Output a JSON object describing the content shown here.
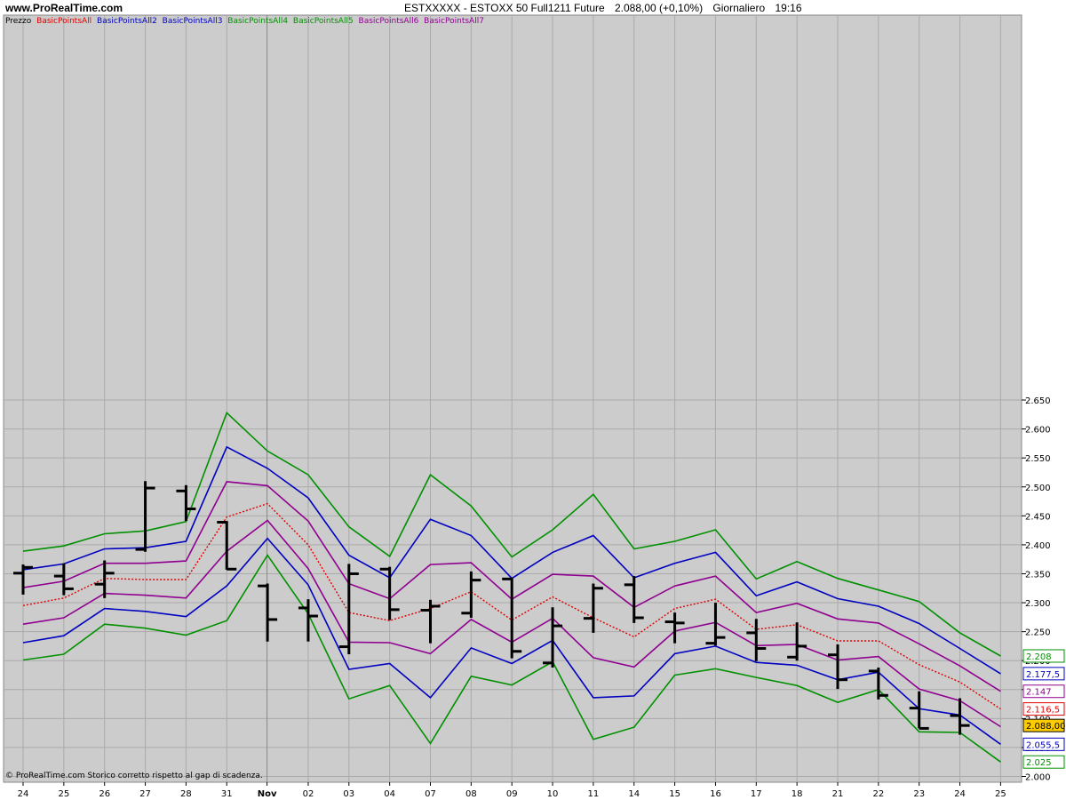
{
  "header": {
    "site": "www.ProRealTime.com",
    "instrument": "ESTXXXXX - ESTOXX 50 Full1211 Future",
    "quote": "2.088,00 (+0,10%)",
    "timeframe": "Giornaliero",
    "time": "19:16"
  },
  "legend": {
    "prezzo": "Prezzo",
    "items": [
      {
        "label": "BasicPointsAll",
        "color": "#e00000"
      },
      {
        "label": "BasicPointsAll2",
        "color": "#0000c0"
      },
      {
        "label": "BasicPointsAll3",
        "color": "#0000c0"
      },
      {
        "label": "BasicPointsAll4",
        "color": "#009000"
      },
      {
        "label": "BasicPointsAll5",
        "color": "#009000"
      },
      {
        "label": "BasicPointsAll6",
        "color": "#900090"
      },
      {
        "label": "BasicPointsAll7",
        "color": "#900090"
      }
    ]
  },
  "footer": "© ProRealTime.com  Storico corretto rispetto al gap di scadenza.",
  "colors": {
    "plot_bg": "#cccccc",
    "grid": "#aaaaaa",
    "red": "#e00000",
    "blue": "#0000c0",
    "green": "#009000",
    "purple": "#900090",
    "price": "#000000",
    "last_price_bg": "#ffcc00"
  },
  "chart_data": {
    "type": "ohlc",
    "x_labels": [
      "24",
      "25",
      "26",
      "27",
      "28",
      "31",
      "Nov",
      "02",
      "03",
      "04",
      "07",
      "08",
      "09",
      "10",
      "11",
      "14",
      "15",
      "16",
      "17",
      "18",
      "21",
      "22",
      "23",
      "24",
      "25"
    ],
    "x_label_bold": "Nov",
    "ylim": [
      2000,
      2660
    ],
    "y_ticks": [
      2000,
      2050,
      2100,
      2150,
      2200,
      2250,
      2300,
      2350,
      2400,
      2450,
      2500,
      2550,
      2600,
      2650
    ],
    "y_tick_labels": [
      "2.000",
      "2.050",
      "2.100",
      "2.150",
      "2.200",
      "2.250",
      "2.300",
      "2.350",
      "2.400",
      "2.450",
      "2.500",
      "2.550",
      "2.600",
      "2.650"
    ],
    "grid": true,
    "ohlc": [
      {
        "o": 2351,
        "h": 2366,
        "l": 2314,
        "c": 2361
      },
      {
        "o": 2346,
        "h": 2368,
        "l": 2313,
        "c": 2324
      },
      {
        "o": 2332,
        "h": 2373,
        "l": 2308,
        "c": 2351
      },
      {
        "o": 2392,
        "h": 2510,
        "l": 2388,
        "c": 2498
      },
      {
        "o": 2493,
        "h": 2503,
        "l": 2441,
        "c": 2462
      },
      {
        "o": 2439,
        "h": 2441,
        "l": 2357,
        "c": 2358
      },
      {
        "o": 2329,
        "h": 2333,
        "l": 2233,
        "c": 2271
      },
      {
        "o": 2291,
        "h": 2306,
        "l": 2233,
        "c": 2277
      },
      {
        "o": 2224,
        "h": 2367,
        "l": 2211,
        "c": 2350
      },
      {
        "o": 2358,
        "h": 2362,
        "l": 2270,
        "c": 2288
      },
      {
        "o": 2287,
        "h": 2305,
        "l": 2230,
        "c": 2294
      },
      {
        "o": 2282,
        "h": 2354,
        "l": 2274,
        "c": 2339
      },
      {
        "o": 2341,
        "h": 2343,
        "l": 2204,
        "c": 2216
      },
      {
        "o": 2196,
        "h": 2292,
        "l": 2188,
        "c": 2260
      },
      {
        "o": 2273,
        "h": 2333,
        "l": 2248,
        "c": 2325
      },
      {
        "o": 2331,
        "h": 2346,
        "l": 2265,
        "c": 2274
      },
      {
        "o": 2267,
        "h": 2283,
        "l": 2230,
        "c": 2265
      },
      {
        "o": 2230,
        "h": 2300,
        "l": 2226,
        "c": 2240
      },
      {
        "o": 2248,
        "h": 2272,
        "l": 2199,
        "c": 2221
      },
      {
        "o": 2206,
        "h": 2266,
        "l": 2200,
        "c": 2225
      },
      {
        "o": 2210,
        "h": 2228,
        "l": 2151,
        "c": 2167
      },
      {
        "o": 2182,
        "h": 2188,
        "l": 2133,
        "c": 2140
      },
      {
        "o": 2118,
        "h": 2147,
        "l": 2083,
        "c": 2083
      },
      {
        "o": 2105,
        "h": 2135,
        "l": 2072,
        "c": 2088
      }
    ],
    "series": [
      {
        "name": "BasicPointsAll",
        "color": "#e00000",
        "dashed": true,
        "values": [
          2295,
          2308,
          2342,
          2340,
          2340,
          2448,
          2471,
          2400,
          2283,
          2269,
          2290,
          2319,
          2270,
          2310,
          2274,
          2241,
          2290,
          2306,
          2254,
          2262,
          2234,
          2234,
          2193,
          2163,
          2116.5
        ]
      },
      {
        "name": "BasicPointsAll2",
        "color": "#0000c0",
        "values": [
          2357,
          2367,
          2393,
          2395,
          2406,
          2569,
          2532,
          2481,
          2382,
          2343,
          2444,
          2416,
          2342,
          2387,
          2416,
          2343,
          2368,
          2387,
          2312,
          2336,
          2307,
          2294,
          2264,
          2221,
          2177.5
        ]
      },
      {
        "name": "BasicPointsAll3",
        "color": "#0000c0",
        "values": [
          2231,
          2243,
          2290,
          2285,
          2276,
          2329,
          2411,
          2331,
          2185,
          2195,
          2136,
          2222,
          2195,
          2235,
          2136,
          2139,
          2212,
          2225,
          2197,
          2192,
          2167,
          2180,
          2117,
          2106,
          2055.5
        ]
      },
      {
        "name": "BasicPointsAll4",
        "color": "#009000",
        "values": [
          2389,
          2398,
          2419,
          2424,
          2440,
          2628,
          2562,
          2521,
          2431,
          2380,
          2521,
          2467,
          2379,
          2426,
          2487,
          2393,
          2406,
          2426,
          2341,
          2371,
          2342,
          2322,
          2302,
          2248,
          2208
        ]
      },
      {
        "name": "BasicPointsAll5",
        "color": "#009000",
        "values": [
          2201,
          2211,
          2263,
          2256,
          2244,
          2269,
          2382,
          2281,
          2134,
          2157,
          2057,
          2173,
          2158,
          2198,
          2064,
          2085,
          2175,
          2186,
          2171,
          2157,
          2128,
          2150,
          2077,
          2076,
          2025
        ]
      },
      {
        "name": "BasicPointsAll6",
        "color": "#900090",
        "values": [
          2326,
          2337,
          2368,
          2368,
          2372,
          2509,
          2502,
          2441,
          2333,
          2307,
          2366,
          2369,
          2306,
          2349,
          2346,
          2292,
          2329,
          2346,
          2283,
          2299,
          2272,
          2265,
          2229,
          2191,
          2147
        ]
      },
      {
        "name": "BasicPointsAll7",
        "color": "#900090",
        "values": [
          2263,
          2274,
          2316,
          2313,
          2308,
          2389,
          2442,
          2359,
          2232,
          2231,
          2212,
          2271,
          2232,
          2273,
          2205,
          2189,
          2251,
          2266,
          2226,
          2228,
          2201,
          2207,
          2151,
          2131,
          2086
        ]
      }
    ],
    "last_value_labels": [
      {
        "text": "2.208",
        "value": 2208,
        "color": "#009000"
      },
      {
        "text": "2.177,5",
        "value": 2177.5,
        "color": "#0000c0"
      },
      {
        "text": "2.147",
        "value": 2147,
        "color": "#900090"
      },
      {
        "text": "2.116,5",
        "value": 2116.5,
        "color": "#e00000"
      },
      {
        "text": "2.088,00",
        "value": 2088,
        "color": "#000000",
        "highlight": true
      },
      {
        "text": "2.055,5",
        "value": 2055.5,
        "color": "#0000c0"
      },
      {
        "text": "2.025",
        "value": 2025,
        "color": "#009000"
      }
    ]
  }
}
